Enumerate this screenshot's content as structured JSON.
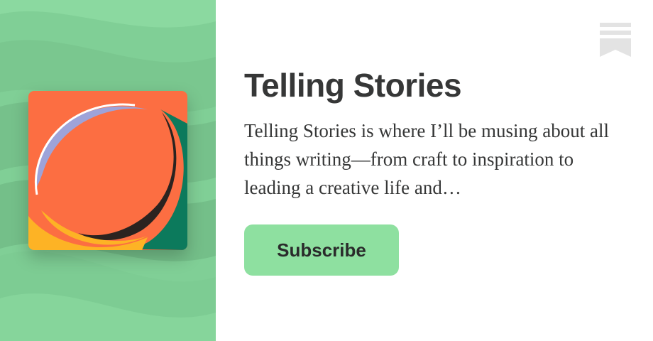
{
  "publication": {
    "title": "Telling Stories",
    "description": "Telling Stories is where I’ll be musing about all things writing—from craft to inspiration to leading a creative life and…",
    "subscribe_label": "Subscribe"
  },
  "colors": {
    "panel_background": "#7fcf95",
    "button_background": "#8ee0a0",
    "text": "#363737",
    "cover_orange": "#fc6e42",
    "cover_teal": "#0c7a5c",
    "cover_yellow": "#fdb325",
    "cover_lavender": "#9ea3d9",
    "bookmark_gray": "#e3e3e3"
  },
  "icons": {
    "logo": "bookmark-icon",
    "cover": "cover-art"
  }
}
